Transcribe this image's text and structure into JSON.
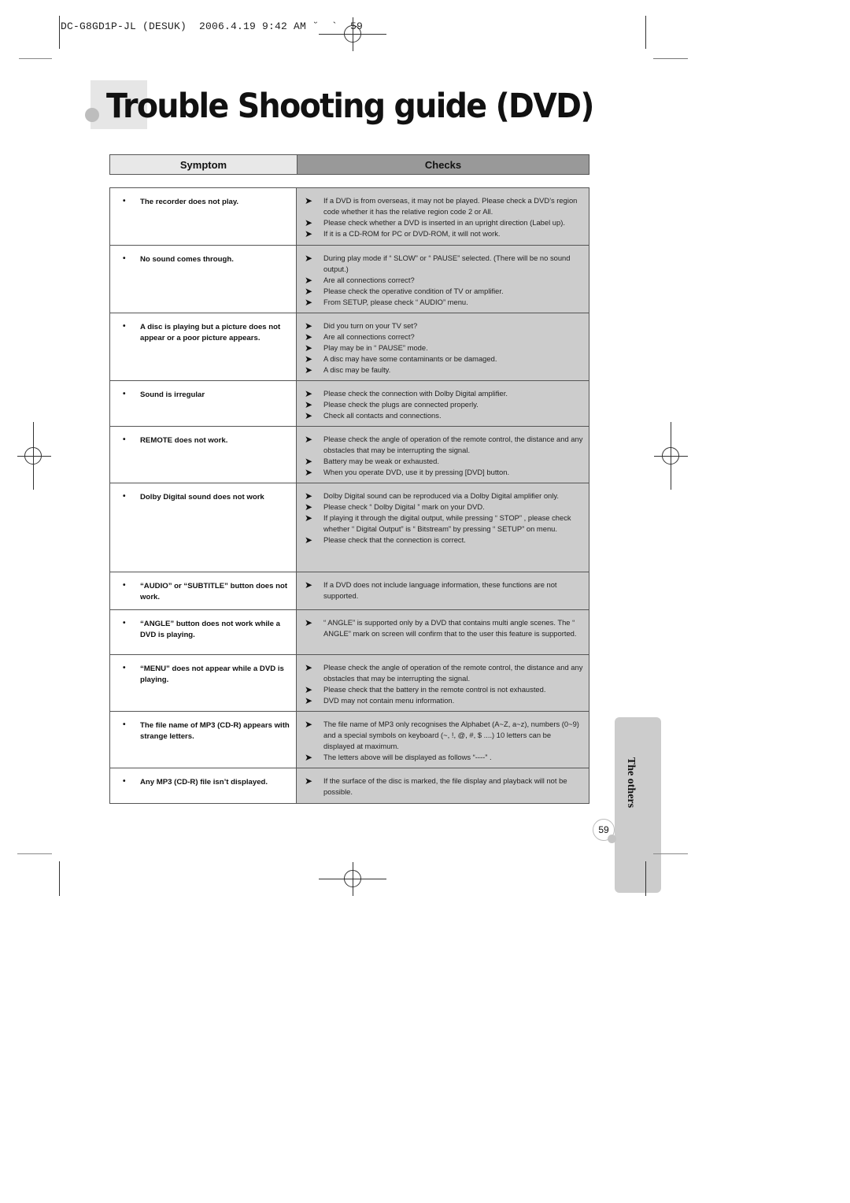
{
  "print_header": {
    "text": "DC-G8GD1P-JL (DESUK)  2006.4.19 9:42 AM ˘  `  59"
  },
  "title": "Trouble Shooting guide (DVD)",
  "table": {
    "header_symptom": "Symptom",
    "header_checks": "Checks",
    "bullet": "•",
    "arrow": "➤",
    "rows": [
      {
        "symptom": "The recorder does not play.",
        "checks": [
          "If  a DVD is from overseas, it may not be played. Please check a DVD’s region code whether it has the relative region code 2 or All.",
          "Please check whether a DVD is inserted in an upright direction (Label up).",
          "If it is a CD-ROM for PC or DVD-ROM, it will not work."
        ]
      },
      {
        "symptom": "No sound comes through.",
        "checks": [
          "During play mode if “ SLOW”  or “ PAUSE”  selected. (There will be no sound output.)",
          "Are all connections correct?",
          "Please check the operative condition of TV or amplifier.",
          "From  SETUP, please check  “ AUDIO”  menu."
        ]
      },
      {
        "symptom": "A disc is playing but a picture does not appear or a poor picture appears.",
        "checks": [
          "Did you turn on your TV set?",
          "Are all connections correct?",
          "Play may be in “ PAUSE”  mode.",
          "A disc may have some contaminants or be damaged.",
          "A disc may be faulty."
        ]
      },
      {
        "symptom": "Sound is irregular",
        "checks": [
          "Please check the connection with Dolby Digital amplifier.",
          "Please check the plugs are connected properly.",
          "Check all contacts and connections."
        ]
      },
      {
        "symptom": "REMOTE does not work.",
        "checks": [
          "Please check the angle of operation of the remote control, the distance and any obstacles that may be interrupting the signal.",
          "Battery may be weak or exhausted.",
          "When you operate DVD, use it by pressing [DVD] button."
        ]
      },
      {
        "symptom": "Dolby Digital  sound does not work",
        "checks": [
          "Dolby Digital  sound can be reproduced via a Dolby Digital amplifier only.",
          "Please check “ Dolby Digital ”  mark on your DVD.",
          "If playing it through the digital output, while pressing “ STOP” , please check whether “ Digital Output”  is “ Bitstream”  by pressing “ SETUP” on menu.",
          "Please check that the connection is correct."
        ]
      },
      {
        "symptom": "“AUDIO” or  “SUBTITLE” button does not work.",
        "checks": [
          "If  a DVD does not include language information, these functions are not supported."
        ]
      },
      {
        "symptom": "“ANGLE” button does not work while a DVD is playing.",
        "checks": [
          "“ ANGLE”  is supported only by a DVD that contains multi angle scenes. The “ ANGLE”  mark on screen will confirm that to the user this feature is supported."
        ]
      },
      {
        "symptom": "“MENU” does not appear while a DVD is playing.",
        "checks": [
          "Please check the angle of operation of the remote control, the distance and any obstacles that may be interrupting the signal.",
          "Please check that the battery in the remote control is not exhausted.",
          "DVD may not contain menu information."
        ]
      },
      {
        "symptom": "The file name of MP3 (CD-R) appears with strange letters.",
        "checks": [
          "The file name of MP3 only recognises the Alphabet (A~Z, a~z), numbers (0~9) and a special symbols on keyboard (~, !, @, #, $ ....) 10 letters can be displayed at maximum.",
          "The letters above will be displayed as follows “----” ."
        ]
      },
      {
        "symptom": "Any MP3 (CD-R) file isn’t displayed.",
        "checks": [
          "If the surface of the disc is marked, the file display and playback will not be possible."
        ]
      }
    ]
  },
  "side_tab": {
    "label": "The others",
    "page_number": "59"
  }
}
